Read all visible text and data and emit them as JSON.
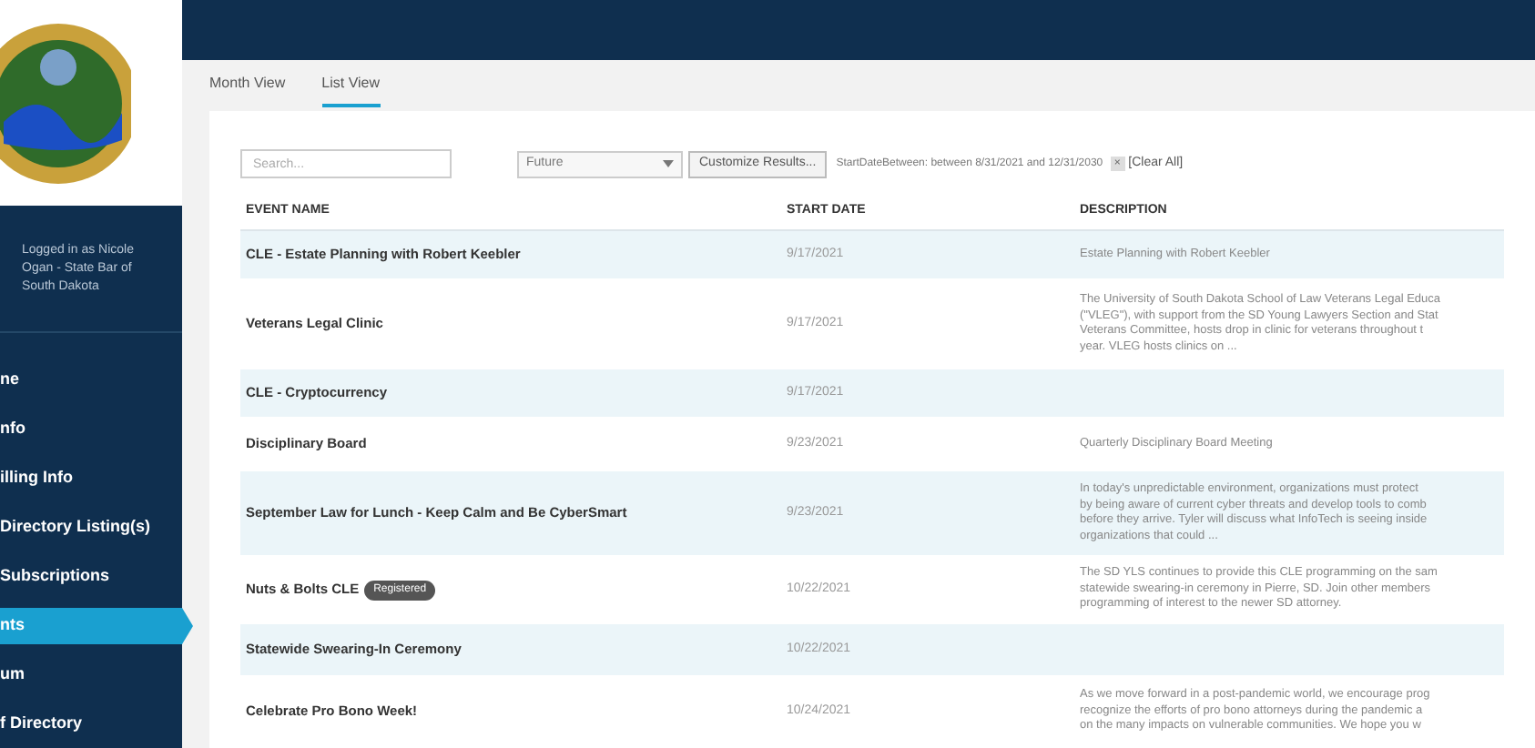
{
  "sidebar": {
    "login_text": "Logged in as Nicole Ogan - State Bar of South Dakota",
    "items": [
      {
        "label": "ne",
        "selected": false
      },
      {
        "label": "nfo",
        "selected": false
      },
      {
        "label": "illing Info",
        "selected": false
      },
      {
        "label": "Directory Listing(s)",
        "selected": false
      },
      {
        "label": "Subscriptions",
        "selected": false
      },
      {
        "label": "nts",
        "selected": true
      },
      {
        "label": "um",
        "selected": false
      },
      {
        "label": "f Directory",
        "selected": false
      }
    ]
  },
  "tabs": [
    {
      "label": "Month View",
      "selected": false
    },
    {
      "label": "List View",
      "selected": true
    }
  ],
  "toolbar": {
    "search": {
      "placeholder": "Search..."
    },
    "filter_select": "Future",
    "customize_button": "Customize Results...",
    "filter_text": "StartDateBetween: between 8/31/2021 and 12/31/2030",
    "remove_filter": "×",
    "clear_all": "[Clear All]"
  },
  "table": {
    "columns": [
      "EVENT NAME",
      "START DATE",
      "DESCRIPTION"
    ],
    "rows": [
      {
        "name": "CLE - Estate Planning with Robert Keebler",
        "start_date": "9/17/2021",
        "description": [
          "Estate Planning with Robert Keebler"
        ]
      },
      {
        "name": "Veterans Legal Clinic",
        "start_date": "9/17/2021",
        "description": [
          "The University of South Dakota School of Law Veterans Legal Educa",
          "(\"VLEG\"), with support from the SD Young Lawyers Section and Stat",
          "Veterans Committee, hosts drop in clinic for veterans throughout t",
          "year. VLEG hosts clinics on ..."
        ]
      },
      {
        "name": "CLE - Cryptocurrency",
        "start_date": "9/17/2021",
        "description": []
      },
      {
        "name": "Disciplinary Board",
        "start_date": "9/23/2021",
        "description": [
          "Quarterly Disciplinary Board Meeting"
        ]
      },
      {
        "name": "September Law for Lunch - Keep Calm and Be CyberSmart",
        "start_date": "9/23/2021",
        "description": [
          "In today's unpredictable environment, organizations must protect",
          "by being aware of current cyber threats and develop tools to comb",
          "before they arrive. Tyler will discuss what InfoTech is seeing inside",
          "organizations that could ..."
        ]
      },
      {
        "name": "Nuts & Bolts CLE",
        "badge": "Registered",
        "start_date": "10/22/2021",
        "description": [
          "The SD YLS continues to provide this CLE programming on the sam",
          "statewide swearing-in ceremony in Pierre, SD. Join other members",
          "programming of interest to the newer SD attorney."
        ]
      },
      {
        "name": "Statewide Swearing-In Ceremony",
        "start_date": "10/22/2021",
        "description": []
      },
      {
        "name": "Celebrate Pro Bono Week!",
        "start_date": "10/24/2021",
        "description": [
          "As we move forward in a post-pandemic world, we encourage prog",
          "recognize the efforts of pro bono attorneys during the pandemic a",
          "on the many impacts on vulnerable communities. We hope you w"
        ]
      }
    ]
  }
}
